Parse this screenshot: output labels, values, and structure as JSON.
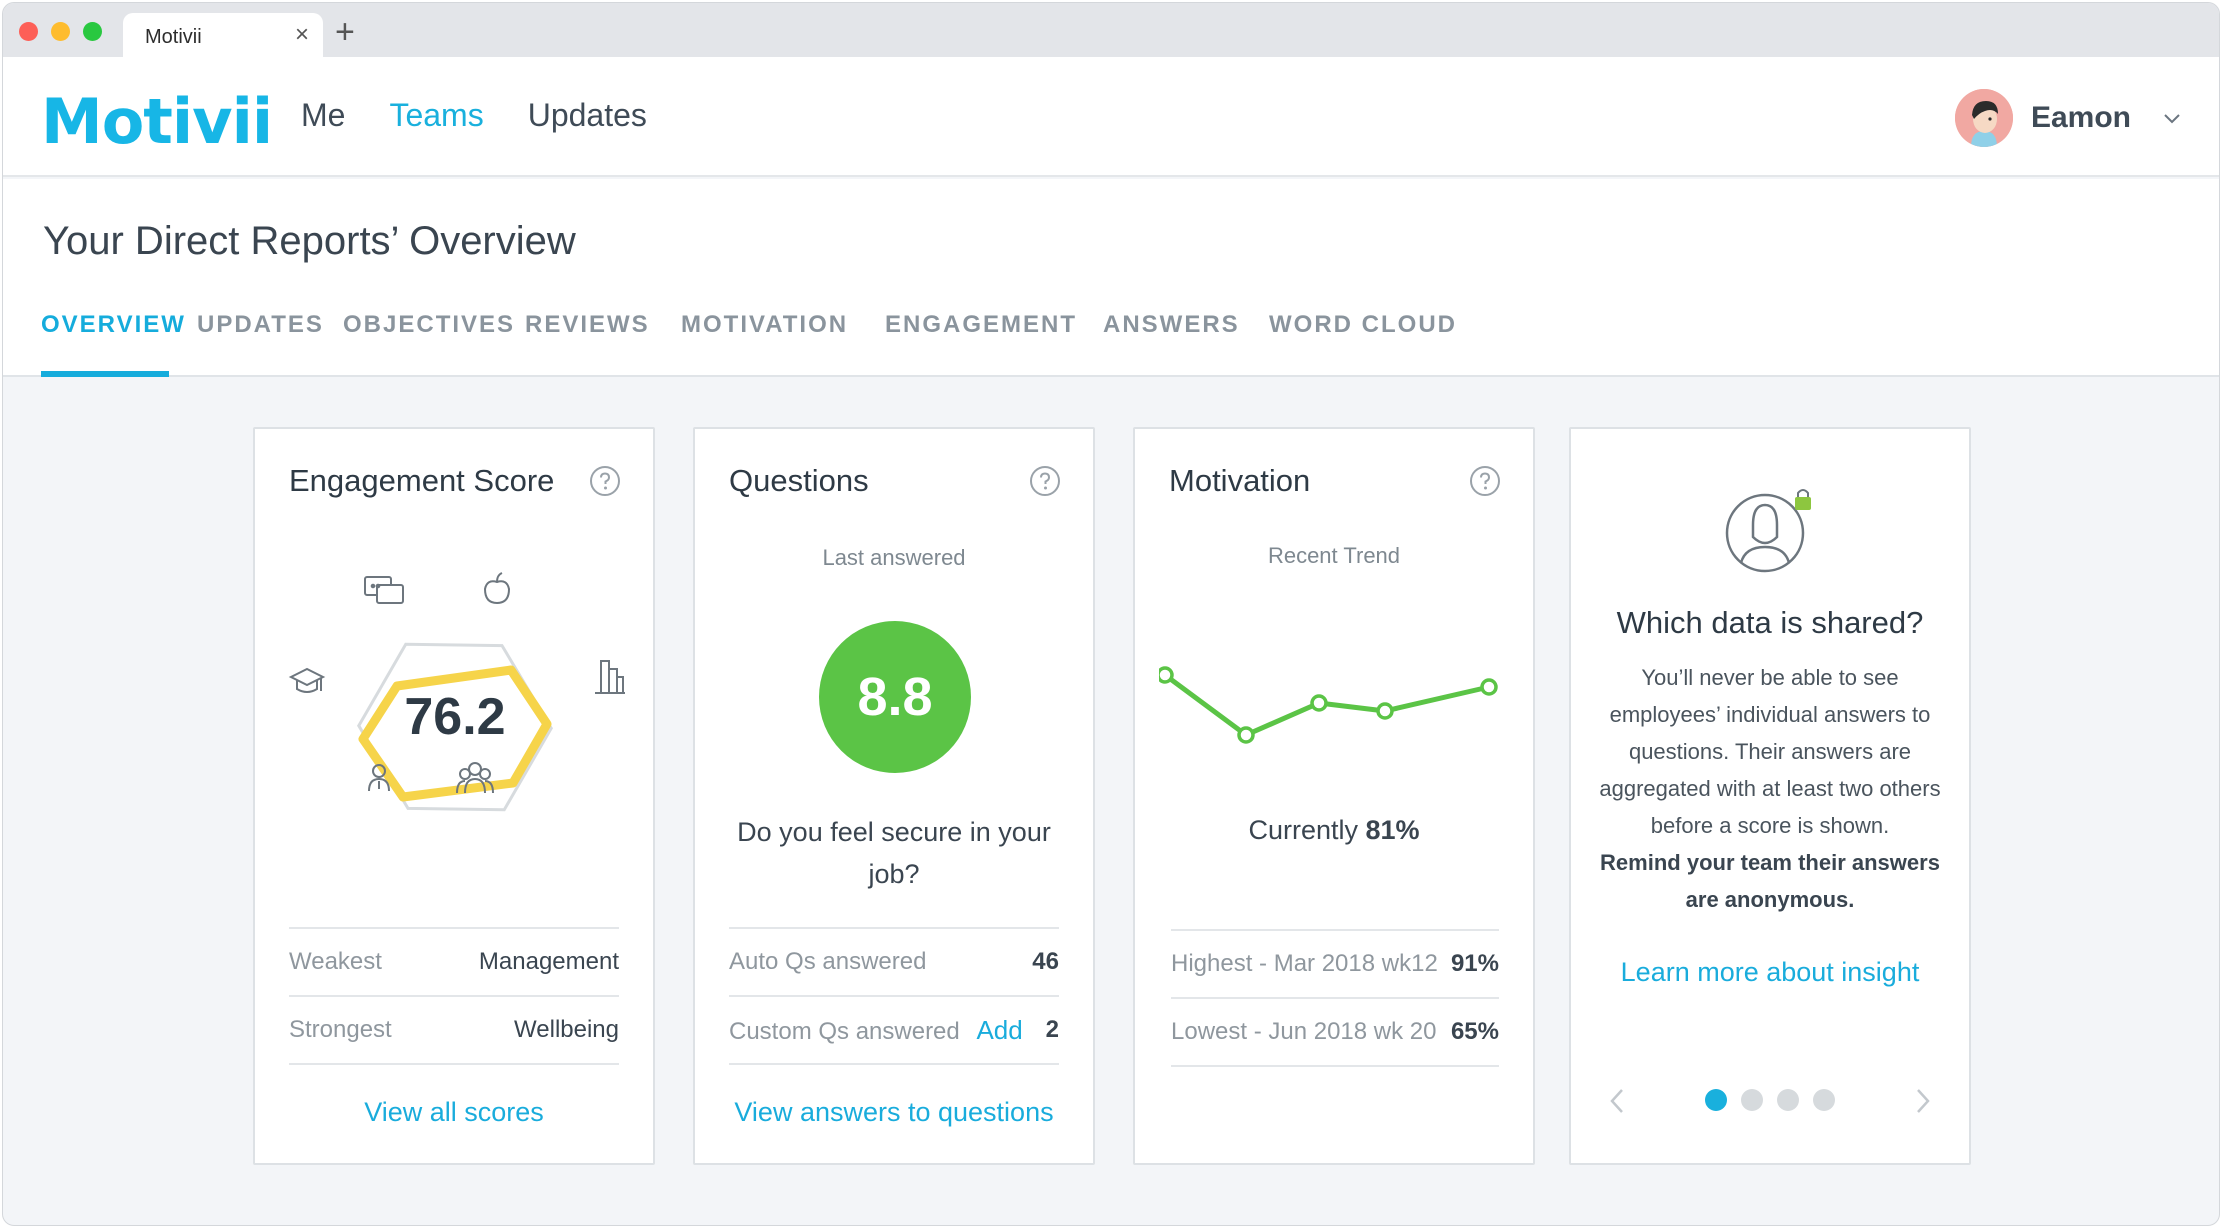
{
  "browser": {
    "tab_title": "Motivii",
    "close_glyph": "×",
    "new_tab_glyph": "+"
  },
  "header": {
    "logo": "Motivii",
    "nav": [
      {
        "label": "Me",
        "active": false
      },
      {
        "label": "Teams",
        "active": true
      },
      {
        "label": "Updates",
        "active": false
      }
    ],
    "user": {
      "name": "Eamon"
    }
  },
  "page": {
    "title": "Your Direct Reports’ Overview",
    "tabs": [
      {
        "label": "OVERVIEW",
        "active": true
      },
      {
        "label": "UPDATES",
        "active": false
      },
      {
        "label": "OBJECTIVES",
        "active": false
      },
      {
        "label": "REVIEWS",
        "active": false
      },
      {
        "label": "MOTIVATION",
        "active": false
      },
      {
        "label": "ENGAGEMENT",
        "active": false
      },
      {
        "label": "ANSWERS",
        "active": false
      },
      {
        "label": "WORD CLOUD",
        "active": false
      }
    ]
  },
  "engagement": {
    "title": "Engagement Score",
    "score": "76.2",
    "weakest_label": "Weakest",
    "weakest_value": "Management",
    "strongest_label": "Strongest",
    "strongest_value": "Wellbeing",
    "link": "View all scores"
  },
  "questions": {
    "title": "Questions",
    "subtitle": "Last answered",
    "score": "8.8",
    "question": "Do you feel secure in your job?",
    "auto_label": "Auto Qs answered",
    "auto_value": "46",
    "custom_label": "Custom Qs answered",
    "custom_add": "Add",
    "custom_value": "2",
    "link": "View answers to questions"
  },
  "motivation": {
    "title": "Motivation",
    "subtitle": "Recent Trend",
    "currently_prefix": "Currently ",
    "currently_value": "81%",
    "trend_values": [
      80,
      65,
      73,
      71,
      77
    ],
    "highest_label": "Highest - Mar 2018 wk12",
    "highest_value": "91%",
    "lowest_label": "Lowest - Jun 2018 wk 20",
    "lowest_value": "65%"
  },
  "info": {
    "title": "Which data is shared?",
    "body": "You’ll never be able to see employees’ individual answers to questions. Their answers are aggregated with at least two others before a score is shown.",
    "bold": "Remind your team their answers are anonymous.",
    "link": "Learn more about insight",
    "dots": [
      true,
      false,
      false,
      false
    ]
  },
  "colors": {
    "brand": "#17b6e6",
    "score_green": "#5bc446",
    "hex_yellow": "#f6d44a",
    "trend_green": "#5bc446"
  }
}
